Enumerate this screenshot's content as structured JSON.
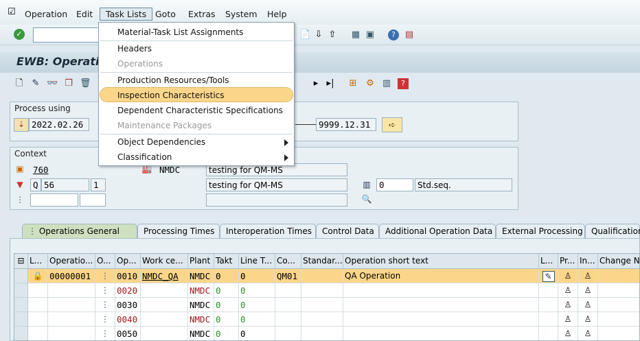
{
  "menubar": {
    "items": [
      "Operation",
      "Edit",
      "Task Lists",
      "Goto",
      "Extras",
      "System",
      "Help"
    ]
  },
  "title": "EWB: Operatio",
  "dropdown": {
    "items": [
      {
        "label": "Material-Task List Assignments",
        "disabled": false
      },
      {
        "label": "Headers",
        "disabled": false
      },
      {
        "label": "Operations",
        "disabled": true
      },
      {
        "label": "Production Resources/Tools",
        "disabled": false
      },
      {
        "label": "Inspection Characteristics",
        "disabled": false
      },
      {
        "label": "Dependent Characteristic Specifications",
        "disabled": false
      },
      {
        "label": "Maintenance Packages",
        "disabled": true
      },
      {
        "label": "Object Dependencies",
        "disabled": false
      },
      {
        "label": "Classification",
        "disabled": false
      }
    ]
  },
  "process_using": {
    "title": "Process using",
    "date_from": "2022.02.26",
    "date_to": "9999.12.31"
  },
  "context": {
    "title": "Context",
    "plant_code": "760",
    "plant": "NMDC",
    "desc1": "testing for QM-MS",
    "type": "Q",
    "group": "56",
    "counter": "1",
    "desc2": "testing for QM-MS",
    "seq": "0",
    "seq_label": "Std.seq."
  },
  "tabs": [
    "Operations General",
    "Processing Times",
    "Interoperation Times",
    "Control Data",
    "Additional Operation Data",
    "External Processing",
    "Qualification"
  ],
  "grid": {
    "headers": [
      "L...",
      "Operatio...",
      "O...",
      "Op...",
      "Work ce...",
      "Plant",
      "Takt",
      "Line T...",
      "Co...",
      "Standar...",
      "Operation short text",
      "L...",
      "Pr...",
      "In...",
      "Change Nu"
    ],
    "rows": [
      {
        "op_id": "00000001",
        "op": "0010",
        "wc": "NMDC_QA",
        "plant": "NMDC",
        "takt": "0",
        "line": "0",
        "co": "QM01",
        "text": "QA Operation"
      },
      {
        "op_id": "",
        "op": "0020",
        "wc": "",
        "plant": "NMDC",
        "takt": "0",
        "line": "0",
        "co": "",
        "text": ""
      },
      {
        "op_id": "",
        "op": "0030",
        "wc": "",
        "plant": "NMDC",
        "takt": "0",
        "line": "0",
        "co": "",
        "text": ""
      },
      {
        "op_id": "",
        "op": "0040",
        "wc": "",
        "plant": "NMDC",
        "takt": "0",
        "line": "0",
        "co": "",
        "text": ""
      },
      {
        "op_id": "",
        "op": "0050",
        "wc": "",
        "plant": "NMDC",
        "takt": "0",
        "line": "0",
        "co": "",
        "text": ""
      }
    ]
  },
  "colors": {
    "highlight": "#fbd68a",
    "accent": "#a01818"
  }
}
